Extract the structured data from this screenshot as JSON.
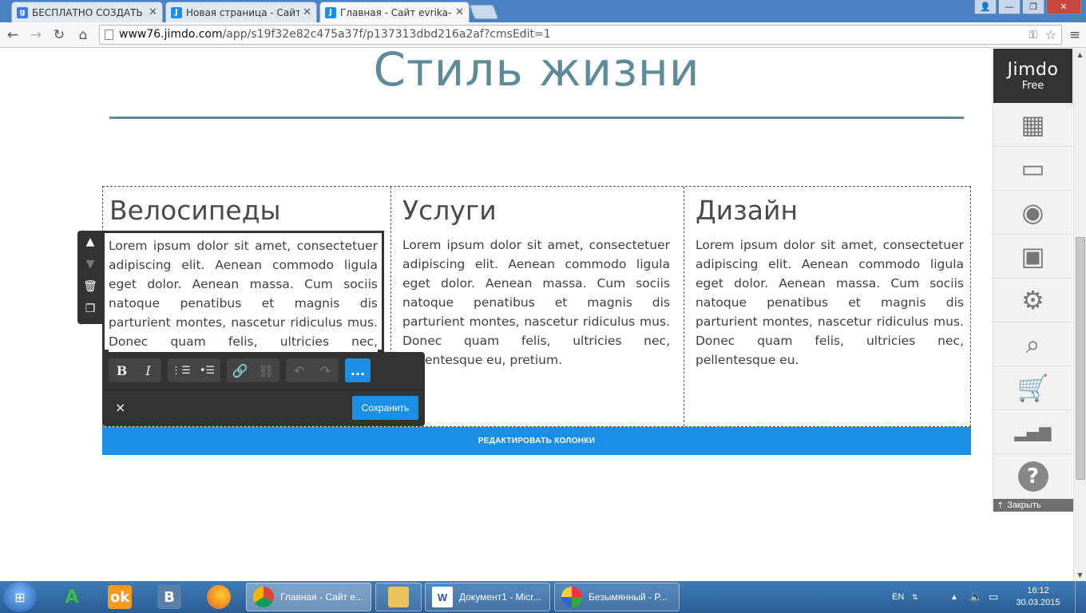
{
  "browser": {
    "tabs": [
      {
        "title": "БЕСПЛАТНО СОЗДАТЬ Са",
        "icon": "google-icon",
        "favicon_letter": "g",
        "favicon_color": "#3b78e7"
      },
      {
        "title": "Новая страница - Сайт e",
        "icon": "jimdo-icon",
        "favicon_letter": "J",
        "favicon_color": "#1a8fe3"
      },
      {
        "title": "Главная - Сайт evrika-pav",
        "icon": "jimdo-icon",
        "favicon_letter": "J",
        "favicon_color": "#1a8fe3"
      }
    ],
    "active_tab": 2,
    "url_domain": "www76.jimdo.com",
    "url_path": "/app/s19f32e82c475a37f/p137313dbd216a2af?cmsEdit=1"
  },
  "page": {
    "site_title": "Стиль жизни",
    "columns": [
      {
        "heading": "Велосипеды",
        "text": "Lorem ipsum dolor sit amet, consectetuer adipiscing elit. Aenean commodo ligula eget dolor. Aenean massa. Cum sociis natoque penatibus et magnis dis parturient montes, nascetur ridiculus mus. Donec quam felis, ultricies nec, pellentesque eu, pretium."
      },
      {
        "heading": "Услуги",
        "text": "Lorem ipsum dolor sit amet, consectetuer adipiscing elit. Aenean commodo ligula eget dolor. Aenean massa. Cum sociis natoque penatibus et magnis dis parturient montes, nascetur ridiculus mus. Donec quam felis, ultricies nec, pellentesque eu, pretium."
      },
      {
        "heading": "Дизайн",
        "text": "Lorem ipsum dolor sit amet, consectetuer adipiscing elit. Aenean commodo ligula eget dolor. Aenean massa. Cum sociis natoque penatibus et magnis dis parturient montes, nascetur ridiculus mus. Donec quam felis, ultricies nec, pellentesque eu."
      }
    ],
    "editor": {
      "more_label": "...",
      "close_label": "×",
      "save_label": "Сохранить"
    },
    "edit_columns_label": "РЕДАКТИРОВАТЬ КОЛОНКИ"
  },
  "jimdo": {
    "logo_main": "Jimdo",
    "logo_sub": "Free",
    "items": [
      {
        "name": "layout-icon",
        "glyph": "▦"
      },
      {
        "name": "paint-roller-icon",
        "glyph": "▭"
      },
      {
        "name": "megaphone-icon",
        "glyph": "◉"
      },
      {
        "name": "package-icon",
        "glyph": "▣"
      },
      {
        "name": "gear-icon",
        "glyph": "⚙"
      },
      {
        "name": "seo-magnifier-icon",
        "glyph": "⌕"
      },
      {
        "name": "shopping-cart-icon",
        "glyph": "🛒"
      },
      {
        "name": "statistics-icon",
        "glyph": "▂▄▆"
      },
      {
        "name": "help-icon",
        "glyph": "?"
      }
    ],
    "close_label": "Закрыть"
  },
  "taskbar": {
    "tasks": [
      {
        "label": "Главная - Сайт e...",
        "icon": "chrome-icon",
        "active": true
      },
      {
        "label": "",
        "icon": "explorer-icon",
        "active": false
      },
      {
        "label": "Документ1 - Micr...",
        "icon": "word-icon",
        "active": false
      },
      {
        "label": "Безымянный - P...",
        "icon": "paint-icon",
        "active": false
      }
    ],
    "language": "EN",
    "time": "16:12",
    "date": "30.03.2015"
  },
  "colors": {
    "accent": "#1a8fe3",
    "title": "#5e8b99",
    "editor_dark": "#333333"
  }
}
